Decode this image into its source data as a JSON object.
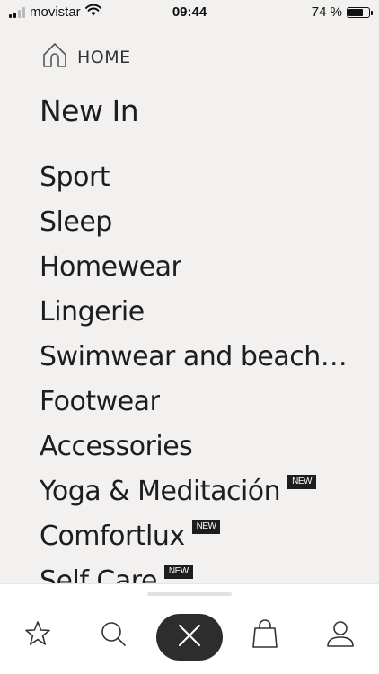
{
  "status_bar": {
    "carrier": "movistar",
    "time": "09:44",
    "battery_percent": "74 %",
    "battery_level": 0.74
  },
  "breadcrumb": {
    "home_label": "HOME",
    "icon": "home-icon"
  },
  "page": {
    "title": "New In"
  },
  "menu": {
    "items": [
      {
        "label": "Sport",
        "badge": ""
      },
      {
        "label": "Sleep",
        "badge": ""
      },
      {
        "label": "Homewear",
        "badge": ""
      },
      {
        "label": "Lingerie",
        "badge": ""
      },
      {
        "label": "Swimwear and beachwear",
        "badge": ""
      },
      {
        "label": "Footwear",
        "badge": ""
      },
      {
        "label": "Accessories",
        "badge": ""
      },
      {
        "label": "Yoga & Meditación",
        "badge": "NEW"
      },
      {
        "label": "Comfortlux",
        "badge": "NEW"
      },
      {
        "label": "Self Care",
        "badge": "NEW"
      }
    ]
  },
  "bottom_nav": {
    "icons": [
      "star-icon",
      "search-icon",
      "close-icon",
      "bag-icon",
      "user-icon"
    ]
  },
  "colors": {
    "background": "#f2f1ef",
    "text": "#1d1d1f",
    "badge_bg": "#1d1d1f",
    "close_button_bg": "#2d2d2d"
  }
}
